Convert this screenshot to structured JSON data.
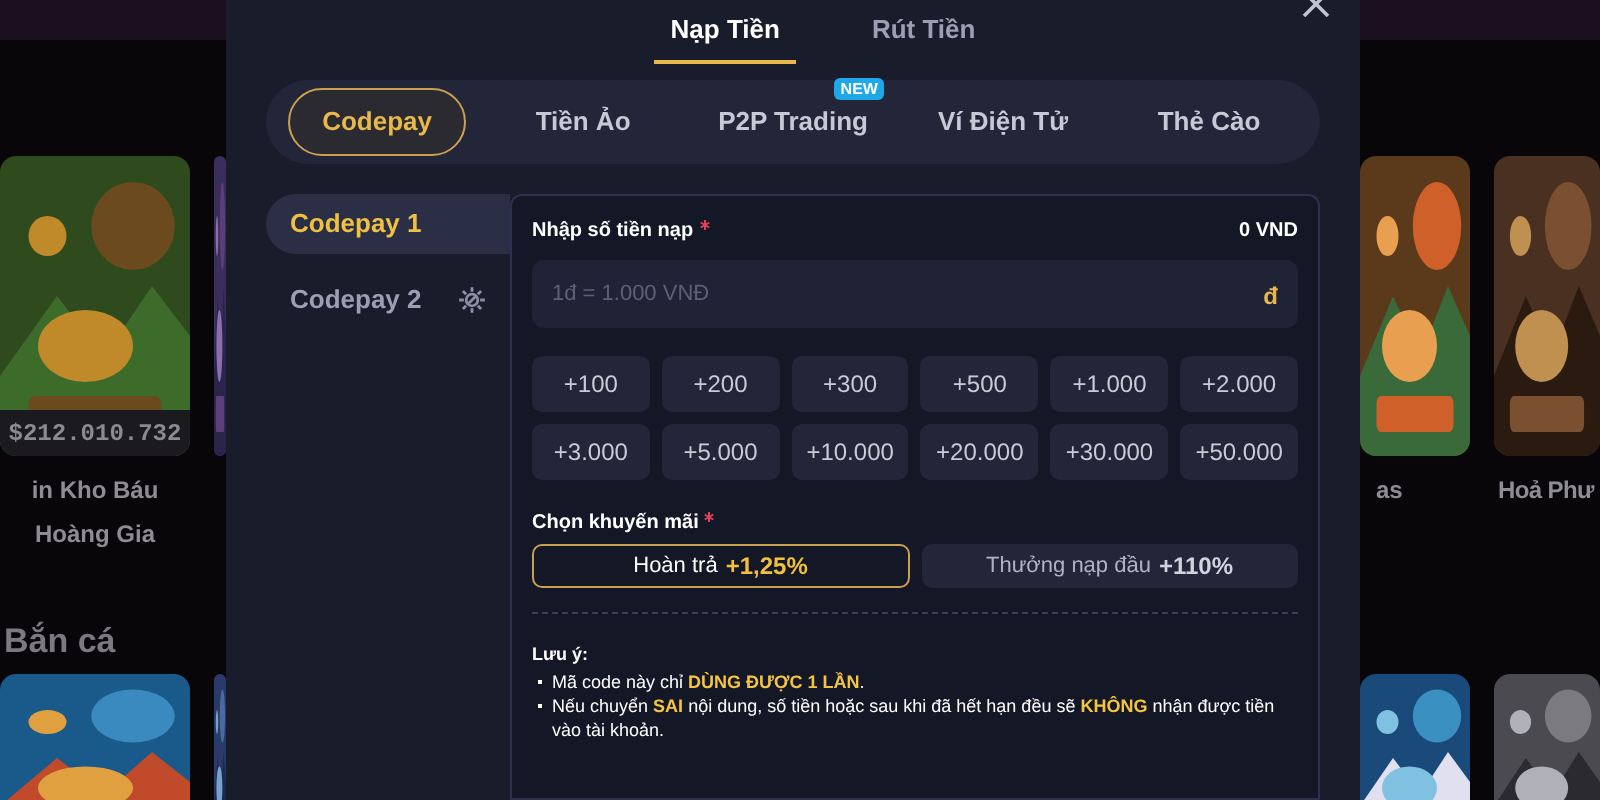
{
  "background": {
    "row_1": {
      "left_tiles": [
        {
          "kind": "game",
          "title": "in Kho Báu Hoàng Gia",
          "jackpot": "$212.010.732"
        },
        {
          "kind": "picture"
        }
      ],
      "right_tiles": [
        {
          "kind": "game",
          "title": "as"
        },
        {
          "kind": "game",
          "title": "Hoả Phư"
        }
      ]
    },
    "section_title": "Bắn cá",
    "row_2": {
      "left_tiles": [
        {
          "kind": "picture"
        },
        {
          "kind": "picture"
        }
      ],
      "right_tiles": [
        {
          "kind": "picture"
        },
        {
          "kind": "picture"
        }
      ]
    }
  },
  "modal": {
    "tabs": [
      {
        "label": "Nạp Tiền",
        "selected": true
      },
      {
        "label": "Rút Tiền",
        "selected": false
      }
    ],
    "methods": [
      {
        "label": "Codepay",
        "selected": true
      },
      {
        "label": "Tiền Ảo",
        "selected": false
      },
      {
        "label": "P2P Trading",
        "selected": false,
        "badge": "NEW"
      },
      {
        "label": "Ví Điện Tử",
        "selected": false
      },
      {
        "label": "Thẻ Cào",
        "selected": false
      }
    ],
    "sub_methods": [
      {
        "label": "Codepay 1",
        "selected": true,
        "maintenance": false
      },
      {
        "label": "Codepay 2",
        "selected": false,
        "maintenance": true
      }
    ],
    "amount": {
      "label": "Nhập số tiền nạp",
      "required": true,
      "balance": "0 VND",
      "placeholder": "1đ = 1.000 VNĐ",
      "suffix": "đ"
    },
    "presets": [
      "+100",
      "+200",
      "+300",
      "+500",
      "+1.000",
      "+2.000",
      "+3.000",
      "+5.000",
      "+10.000",
      "+20.000",
      "+30.000",
      "+50.000"
    ],
    "promo": {
      "label": "Chọn khuyến mãi",
      "required": true,
      "options": [
        {
          "label": "Hoàn trả",
          "value": "+1,25%",
          "selected": true
        },
        {
          "label": "Thưởng nạp đầu",
          "value": "+110%",
          "selected": false
        }
      ]
    },
    "notes": {
      "title": "Lưu ý:",
      "items": [
        "Mã code này chỉ **DÙNG ĐƯỢC 1 LẦN**.",
        "Nếu chuyển **SAI** nội dung, số tiền hoặc sau khi đã hết hạn đều sẽ **KHÔNG** nhận được tiền vào tài khoản."
      ]
    }
  }
}
